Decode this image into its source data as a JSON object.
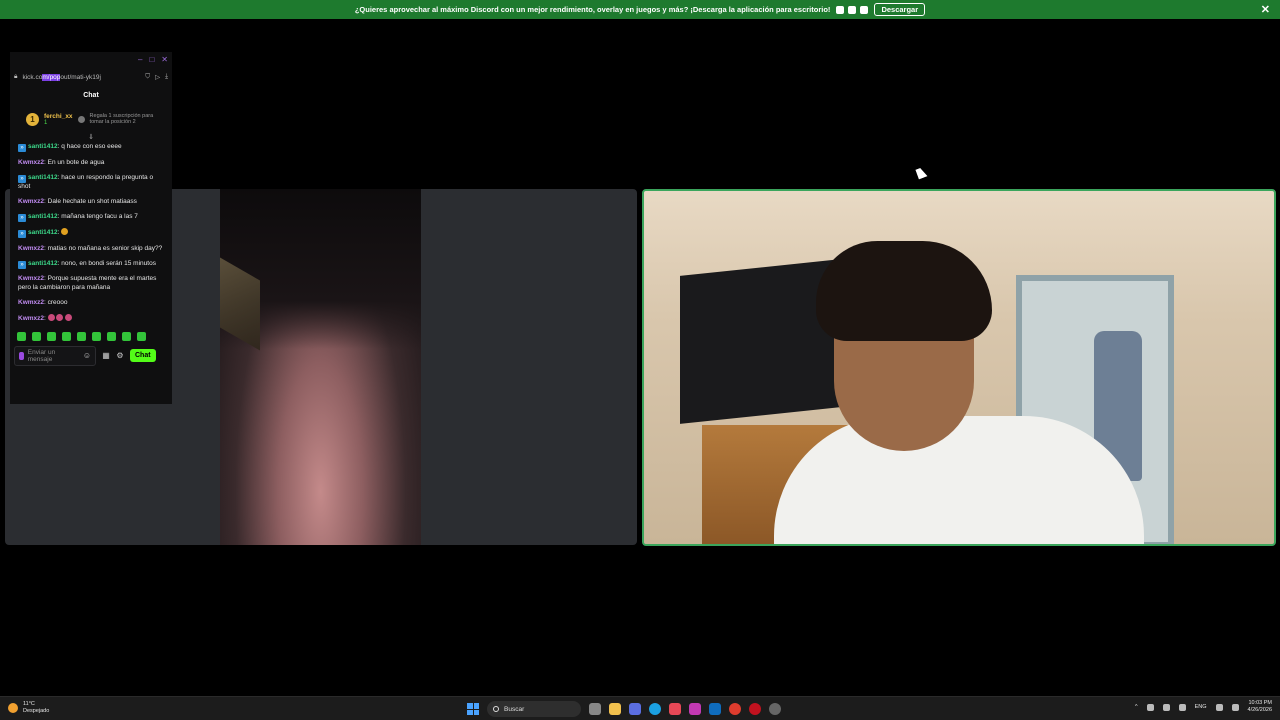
{
  "banner": {
    "message": "¿Quieres aprovechar al máximo Discord con un mejor rendimiento, overlay en juegos y más? ¡Descarga la aplicación para escritorio!",
    "download_label": "Descargar",
    "close_glyph": "✕"
  },
  "chat_window": {
    "url_prefix": "kick.co",
    "url_highlight": "m/pop",
    "url_suffix": "out/mati-yk19j",
    "title": "Chat",
    "top_supporter": {
      "rank": "1",
      "name": "ferchi_xx",
      "count": "1",
      "gift_note": "Regala 1 suscripción para tomar la posición 2"
    },
    "scroll_glyph": "⇓",
    "messages": [
      {
        "user": "santi1412",
        "text": "q hace con eso eeee"
      },
      {
        "user": "Kwmxz2",
        "text": "En un bote de agua"
      },
      {
        "user": "santi1412",
        "text": "hace un respondo la pregunta o shot"
      },
      {
        "user": "Kwmxz2",
        "text": "Dale hechate un shot matiaass"
      },
      {
        "user": "santi1412",
        "text": "mañana tengo facu a las 7"
      },
      {
        "user": "santi1412",
        "text": ""
      },
      {
        "user": "Kwmxz2",
        "text": "matias no mañana es senior skip day??"
      },
      {
        "user": "santi1412",
        "text": "nono, en bondi serán 15 minutos"
      },
      {
        "user": "Kwmxz2",
        "text": "Porque supuesta mente era el martes pero la cambiaron para mañana"
      },
      {
        "user": "Kwmxz2",
        "text": "creooo"
      },
      {
        "user": "Kwmxz2",
        "text": ""
      }
    ],
    "input_placeholder": "Enviar un mensaje",
    "send_label": "Chat"
  },
  "taskbar": {
    "temperature": "11°C",
    "weather": "Despejado",
    "search_label": "Buscar",
    "language": "ENG",
    "time": "10:03 PM",
    "date": "4/26/2026"
  },
  "colors": {
    "banner": "#1e7a2e",
    "kick_green": "#53fc18",
    "speaking_border": "#3ba55c"
  }
}
